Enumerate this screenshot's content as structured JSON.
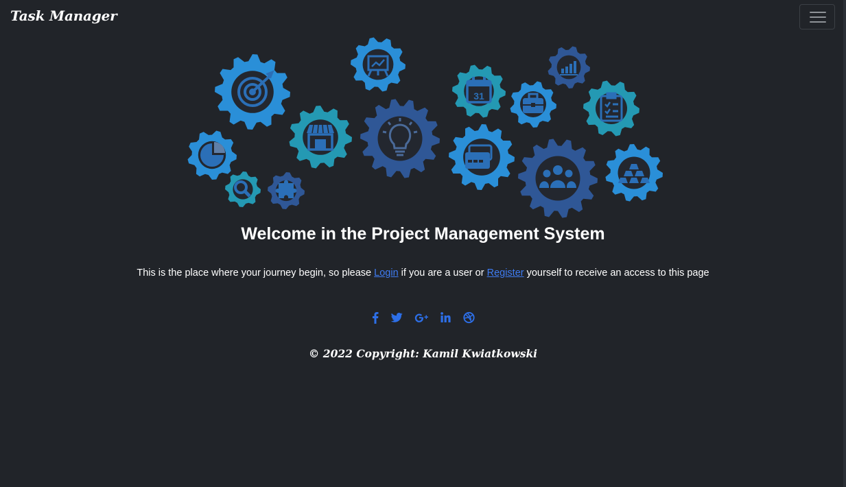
{
  "navbar": {
    "brand": "Task Manager",
    "toggler_icon": "hamburger-menu-icon"
  },
  "hero": {
    "gear_icons": [
      "target-icon",
      "presentation-chart-icon",
      "calendar-icon",
      "bar-chart-icon",
      "briefcase-icon",
      "checklist-icon",
      "pie-chart-icon",
      "storefront-icon",
      "lightbulb-icon",
      "credit-card-icon",
      "team-icon",
      "gold-bars-icon",
      "magnifier-icon",
      "puzzle-icon"
    ],
    "calendar_day": "31",
    "colors": {
      "light_blue": "#2a8fd8",
      "teal": "#2499b3",
      "navy": "#2f5796",
      "dark_center": "#23272f"
    }
  },
  "main": {
    "title": "Welcome in the Project Management System",
    "intro_before": "This is the place where your journey begin, so please ",
    "login_label": "Login",
    "intro_middle": " if you are a user or ",
    "register_label": "Register",
    "intro_after": " yourself to receive an access to this page"
  },
  "social": {
    "links": [
      {
        "icon": "facebook-icon"
      },
      {
        "icon": "twitter-icon"
      },
      {
        "icon": "google-plus-icon"
      },
      {
        "icon": "linkedin-icon"
      },
      {
        "icon": "dribbble-icon"
      }
    ],
    "color": "#2d6fe8"
  },
  "footer": {
    "copyright": "© 2022 Copyright: Kamil Kwiatkowski"
  },
  "colors": {
    "background": "#212429",
    "link": "#3f7cf2",
    "text": "#ffffff"
  }
}
